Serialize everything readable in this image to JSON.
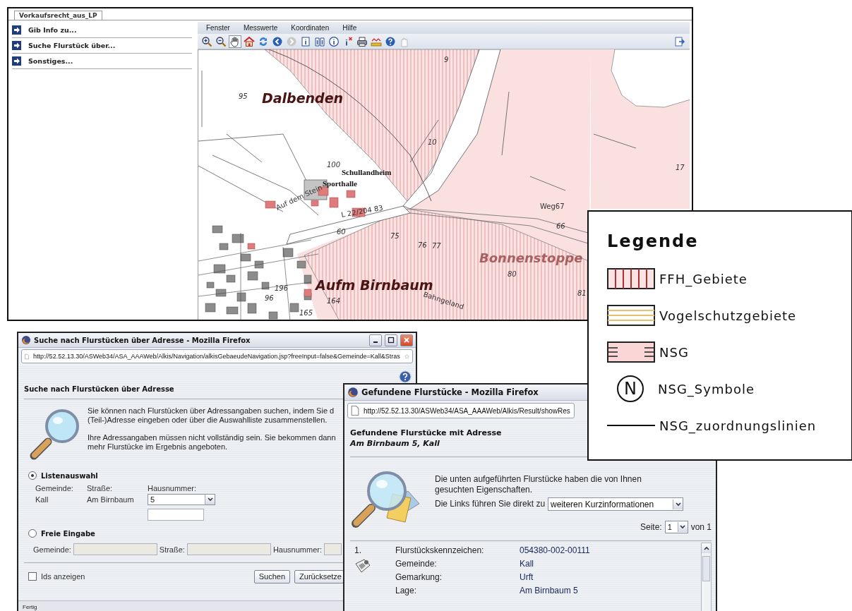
{
  "main_window": {
    "tab": "Vorkaufsrecht_aus_LP",
    "sidebar": {
      "items": [
        {
          "label": "Gib Info zu..."
        },
        {
          "label": "Suche Flurstück über..."
        },
        {
          "label": "Sonstiges..."
        }
      ]
    },
    "menu": [
      "Fenster",
      "Messwerte",
      "Koordinaten",
      "Hilfe"
    ],
    "toolbar": {
      "tools": [
        {
          "kind": "zoom-in",
          "selected": false
        },
        {
          "kind": "zoom-out",
          "selected": false
        },
        {
          "kind": "pan",
          "selected": true
        },
        {
          "kind": "home",
          "selected": false
        },
        {
          "kind": "refresh",
          "selected": false
        },
        {
          "kind": "back",
          "selected": false
        },
        {
          "kind": "forward",
          "selected": false
        },
        {
          "kind": "info-square",
          "selected": false
        },
        {
          "kind": "info-book",
          "selected": false
        },
        {
          "kind": "info-circle",
          "selected": false
        },
        {
          "kind": "info-remove",
          "selected": false
        },
        {
          "kind": "print",
          "selected": false
        },
        {
          "kind": "measure",
          "selected": false
        },
        {
          "kind": "help",
          "selected": false
        },
        {
          "kind": "select",
          "selected": false
        }
      ]
    },
    "map": {
      "labels": [
        {
          "text": "95",
          "kind": "number"
        },
        {
          "text": "Dalbenden",
          "kind": "place"
        },
        {
          "text": "9",
          "kind": "number"
        },
        {
          "text": "10",
          "kind": "number"
        },
        {
          "text": "17",
          "kind": "number"
        },
        {
          "text": "100",
          "kind": "number"
        },
        {
          "text": "Schullandheim",
          "kind": "building"
        },
        {
          "text": "Sporthalle",
          "kind": "building"
        },
        {
          "text": "L 22/204 83",
          "kind": "road"
        },
        {
          "text": "Weg67",
          "kind": "road"
        },
        {
          "text": "66",
          "kind": "number"
        },
        {
          "text": "60",
          "kind": "number"
        },
        {
          "text": "75",
          "kind": "number"
        },
        {
          "text": "76",
          "kind": "number"
        },
        {
          "text": "77",
          "kind": "number"
        },
        {
          "text": "80",
          "kind": "number"
        },
        {
          "text": "81",
          "kind": "number"
        },
        {
          "text": "Bonnenstoppe",
          "kind": "place-nsg"
        },
        {
          "text": "196",
          "kind": "number"
        },
        {
          "text": "Aufm Birnbaum",
          "kind": "place"
        },
        {
          "text": "164",
          "kind": "number"
        },
        {
          "text": "165",
          "kind": "number"
        },
        {
          "text": "96",
          "kind": "number"
        },
        {
          "text": "Auf dem Stein",
          "kind": "road"
        },
        {
          "text": "Bahngeland",
          "kind": "road"
        }
      ]
    }
  },
  "legend": {
    "title": "Legende",
    "items": [
      {
        "kind": "ffh",
        "label": "FFH_Gebiete"
      },
      {
        "kind": "bird",
        "label": "Vogelschutzgebiete"
      },
      {
        "kind": "nsg",
        "label": "NSG"
      },
      {
        "kind": "symbol",
        "symbol": "N",
        "label": "NSG_Symbole"
      },
      {
        "kind": "line",
        "label": "NSG_zuordnungslinien"
      }
    ]
  },
  "search_window": {
    "title": "Suche nach Flurstücken über Adresse - Mozilla Firefox",
    "url": "http://52.52.13.30/ASWeb34/ASA_AAAWeb/Alkis/Navigation/alkisGebaeudeNavigation.jsp?freeInput=false&Gemeinde=Kall&Stras",
    "heading": "Suche nach Flurstücken über Adresse",
    "intro": [
      [
        "Sie können nach Flurstücken über Adressangaben suchen, indem Sie d",
        "(Teil-)Adresse eingeben oder über die Auswahlliste zusammenstellen."
      ],
      [
        "Ihre Adressangaben müssen nicht vollständig sein. Sie bekommen dann",
        "mehr Flurstücke im Ergebnis angeboten."
      ]
    ],
    "list_mode": {
      "label": "Listenauswahl",
      "selected": true,
      "columns": [
        "Gemeinde:",
        "Straße:",
        "Hausnummer:"
      ],
      "gemeinde": "Kall",
      "strasse": "Am Birnbaum",
      "hausnummer": "5"
    },
    "free_mode": {
      "label": "Freie Eingabe",
      "selected": false,
      "fields": [
        {
          "label": "Gemeinde:",
          "disabled": true
        },
        {
          "label": "Straße:",
          "disabled": true
        },
        {
          "label": "Hausnummer:",
          "disabled": true
        }
      ]
    },
    "show_ids": {
      "label": "Ids anzeigen",
      "checked": false
    },
    "buttons": [
      "Suchen",
      "Zurücksetze"
    ],
    "status": "Fertig"
  },
  "result_window": {
    "title": "Gefundene Flurstücke - Mozilla Firefox",
    "url": "http://52.52.13.30/ASWeb34/ASA_AAAWeb/Alkis/Result/showRes",
    "heading": "Gefundene Flurstücke mit Adresse",
    "address": "Am Birnbaum 5, Kall",
    "info_lines": [
      "Die unten aufgeführten Flurstücke haben die von Ihnen",
      "gesuchten Eigenschaften."
    ],
    "links_label": "Die Links führen Sie direkt zu",
    "links_select": "weiteren Kurzinformationen",
    "page_label": "Seite:",
    "page_select": "1",
    "page_total": "von 1",
    "results": [
      {
        "number": "1.",
        "fields": [
          {
            "label": "Flurstückskennzeichen:",
            "value": "054380-002-00111"
          },
          {
            "label": "Gemeinde:",
            "value": "Kall"
          },
          {
            "label": "Gemarkung:",
            "value": "Urft"
          },
          {
            "label": "Lage:",
            "value": "Am Birnbaum 5"
          }
        ]
      }
    ]
  }
}
